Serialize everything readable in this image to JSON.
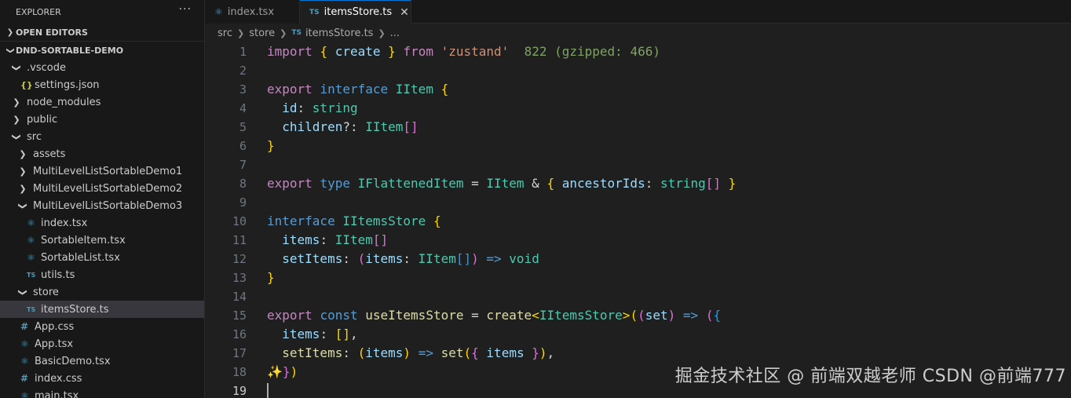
{
  "explorer": {
    "title": "EXPLORER",
    "more": "···",
    "open_editors": "OPEN EDITORS",
    "project": "DND-SORTABLE-DEMO",
    "tree": [
      {
        "label": ".vscode",
        "depth": 1,
        "kind": "folder-open"
      },
      {
        "label": "settings.json",
        "depth": 2,
        "kind": "json",
        "icon": "{}"
      },
      {
        "label": "node_modules",
        "depth": 1,
        "kind": "folder-closed"
      },
      {
        "label": "public",
        "depth": 1,
        "kind": "folder-closed"
      },
      {
        "label": "src",
        "depth": 1,
        "kind": "folder-open"
      },
      {
        "label": "assets",
        "depth": 2,
        "kind": "folder-closed"
      },
      {
        "label": "MultiLevelListSortableDemo1",
        "depth": 2,
        "kind": "folder-closed"
      },
      {
        "label": "MultiLevelListSortableDemo2",
        "depth": 2,
        "kind": "folder-closed"
      },
      {
        "label": "MultiLevelListSortableDemo3",
        "depth": 2,
        "kind": "folder-open"
      },
      {
        "label": "index.tsx",
        "depth": 3,
        "kind": "react"
      },
      {
        "label": "SortableItem.tsx",
        "depth": 3,
        "kind": "react"
      },
      {
        "label": "SortableList.tsx",
        "depth": 3,
        "kind": "react"
      },
      {
        "label": "utils.ts",
        "depth": 3,
        "kind": "ts",
        "icon": "TS"
      },
      {
        "label": "store",
        "depth": 2,
        "kind": "folder-open"
      },
      {
        "label": "itemsStore.ts",
        "depth": 3,
        "kind": "ts",
        "icon": "TS",
        "selected": true
      },
      {
        "label": "App.css",
        "depth": 2,
        "kind": "css",
        "icon": "#"
      },
      {
        "label": "App.tsx",
        "depth": 2,
        "kind": "react"
      },
      {
        "label": "BasicDemo.tsx",
        "depth": 2,
        "kind": "react"
      },
      {
        "label": "index.css",
        "depth": 2,
        "kind": "css",
        "icon": "#"
      },
      {
        "label": "main.tsx",
        "depth": 2,
        "kind": "react"
      }
    ]
  },
  "tabs": [
    {
      "label": "index.tsx",
      "icon": "react-icon",
      "active": false
    },
    {
      "label": "itemsStore.ts",
      "icon": "TS",
      "active": true,
      "close": "✕"
    }
  ],
  "breadcrumb": {
    "parts": [
      "src",
      "store",
      "itemsStore.ts",
      "..."
    ],
    "ts_icon": "TS"
  },
  "editor": {
    "current_line": 19,
    "lines": [
      [
        [
          "kw",
          "import"
        ],
        [
          "pn",
          " "
        ],
        [
          "b1",
          "{"
        ],
        [
          "pn",
          " "
        ],
        [
          "var",
          "create"
        ],
        [
          "pn",
          " "
        ],
        [
          "b1",
          "}"
        ],
        [
          "pn",
          " "
        ],
        [
          "kw",
          "from"
        ],
        [
          "pn",
          " "
        ],
        [
          "str",
          "'zustand'"
        ],
        [
          "pn",
          "  "
        ],
        [
          "hint",
          "822 (gzipped: 466)"
        ]
      ],
      [],
      [
        [
          "kw",
          "export"
        ],
        [
          "pn",
          " "
        ],
        [
          "kwb",
          "interface"
        ],
        [
          "pn",
          " "
        ],
        [
          "ty",
          "IItem"
        ],
        [
          "pn",
          " "
        ],
        [
          "b1",
          "{"
        ]
      ],
      [
        [
          "pn",
          "  "
        ],
        [
          "var",
          "id"
        ],
        [
          "pn",
          ": "
        ],
        [
          "ty",
          "string"
        ]
      ],
      [
        [
          "pn",
          "  "
        ],
        [
          "var",
          "children"
        ],
        [
          "pn",
          "?: "
        ],
        [
          "ty",
          "IItem"
        ],
        [
          "b2",
          "[]"
        ]
      ],
      [
        [
          "b1",
          "}"
        ]
      ],
      [],
      [
        [
          "kw",
          "export"
        ],
        [
          "pn",
          " "
        ],
        [
          "kwb",
          "type"
        ],
        [
          "pn",
          " "
        ],
        [
          "ty",
          "IFlattenedItem"
        ],
        [
          "pn",
          " = "
        ],
        [
          "ty",
          "IItem"
        ],
        [
          "pn",
          " & "
        ],
        [
          "b1",
          "{"
        ],
        [
          "pn",
          " "
        ],
        [
          "var",
          "ancestorIds"
        ],
        [
          "pn",
          ": "
        ],
        [
          "ty",
          "string"
        ],
        [
          "b2",
          "[]"
        ],
        [
          "pn",
          " "
        ],
        [
          "b1",
          "}"
        ]
      ],
      [],
      [
        [
          "kwb",
          "interface"
        ],
        [
          "pn",
          " "
        ],
        [
          "ty",
          "IItemsStore"
        ],
        [
          "pn",
          " "
        ],
        [
          "b1",
          "{"
        ]
      ],
      [
        [
          "pn",
          "  "
        ],
        [
          "var",
          "items"
        ],
        [
          "pn",
          ": "
        ],
        [
          "ty",
          "IItem"
        ],
        [
          "b2",
          "[]"
        ]
      ],
      [
        [
          "pn",
          "  "
        ],
        [
          "var",
          "setItems"
        ],
        [
          "pn",
          ": "
        ],
        [
          "b2",
          "("
        ],
        [
          "var",
          "items"
        ],
        [
          "pn",
          ": "
        ],
        [
          "ty",
          "IItem"
        ],
        [
          "b3",
          "[]"
        ],
        [
          "b2",
          ")"
        ],
        [
          "pn",
          " "
        ],
        [
          "kwb",
          "=>"
        ],
        [
          "pn",
          " "
        ],
        [
          "ty",
          "void"
        ]
      ],
      [
        [
          "b1",
          "}"
        ]
      ],
      [],
      [
        [
          "kw",
          "export"
        ],
        [
          "pn",
          " "
        ],
        [
          "kwb",
          "const"
        ],
        [
          "pn",
          " "
        ],
        [
          "fn",
          "useItemsStore"
        ],
        [
          "pn",
          " = "
        ],
        [
          "fn",
          "create"
        ],
        [
          "b1",
          "<"
        ],
        [
          "ty",
          "IItemsStore"
        ],
        [
          "b1",
          ">"
        ],
        [
          "b1",
          "("
        ],
        [
          "b2",
          "("
        ],
        [
          "var",
          "set"
        ],
        [
          "b2",
          ")"
        ],
        [
          "pn",
          " "
        ],
        [
          "kwb",
          "=>"
        ],
        [
          "pn",
          " "
        ],
        [
          "b2",
          "("
        ],
        [
          "b3",
          "{"
        ]
      ],
      [
        [
          "pn",
          "  "
        ],
        [
          "var",
          "items"
        ],
        [
          "pn",
          ": "
        ],
        [
          "b1",
          "[]"
        ],
        [
          "pn",
          ","
        ]
      ],
      [
        [
          "pn",
          "  "
        ],
        [
          "fn",
          "setItems"
        ],
        [
          "pn",
          ": "
        ],
        [
          "b1",
          "("
        ],
        [
          "var",
          "items"
        ],
        [
          "b1",
          ")"
        ],
        [
          "pn",
          " "
        ],
        [
          "kwb",
          "=>"
        ],
        [
          "pn",
          " "
        ],
        [
          "fn",
          "set"
        ],
        [
          "b1",
          "("
        ],
        [
          "b2",
          "{"
        ],
        [
          "pn",
          " "
        ],
        [
          "var",
          "items"
        ],
        [
          "pn",
          " "
        ],
        [
          "b2",
          "}"
        ],
        [
          "b1",
          ")"
        ],
        [
          "pn",
          ","
        ]
      ],
      [
        [
          "sparkle",
          "✨"
        ],
        [
          "b2",
          "}"
        ],
        [
          "b1",
          ")"
        ]
      ],
      []
    ]
  },
  "watermark": "掘金技术社区 @ 前端双越老师 CSDN @前端777"
}
